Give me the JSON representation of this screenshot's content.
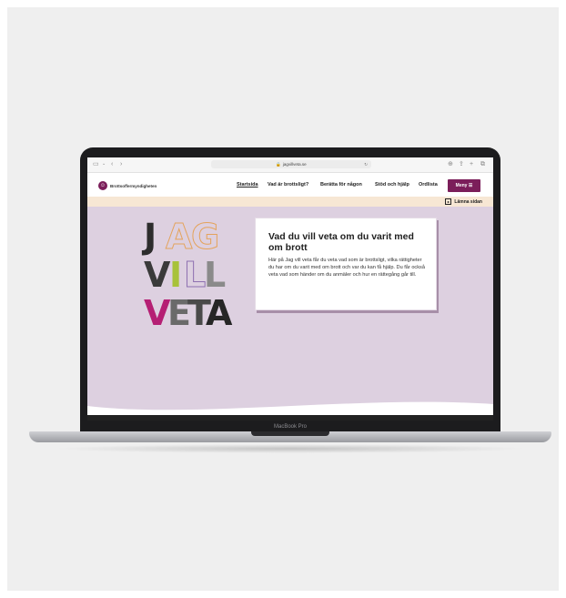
{
  "browser": {
    "url": "jagvillveta.se",
    "icons": [
      "sidebar-icon",
      "chevron-down-icon",
      "back-icon",
      "forward-icon",
      "download-icon",
      "share-icon",
      "new-tab-icon",
      "tabs-icon"
    ]
  },
  "site": {
    "logo_text": "Brottsoffermyndigheten",
    "nav": [
      "Startsida",
      "Vad är brottsligt?",
      "Berätta för någon",
      "Stöd och hjälp",
      "Ordlista"
    ],
    "active_nav": "Startsida",
    "menu_label": "Meny",
    "leave_label": "Lämna sidan",
    "brand_color": "#7b1e5a"
  },
  "hero": {
    "letters": [
      "J",
      "A",
      "G",
      "V",
      "I",
      "L",
      "L",
      "V",
      "E",
      "T",
      "A"
    ],
    "card_title": "Vad du vill veta om du varit med om brott",
    "card_body": "Här på Jag vill veta får du veta vad som är brottsligt, vilka rättigheter du har om du varit med om brott och var du kan få hjälp. Du får också veta vad som händer om du anmäler och hur en rättegång går till."
  },
  "device": {
    "label": "MacBook Pro"
  }
}
